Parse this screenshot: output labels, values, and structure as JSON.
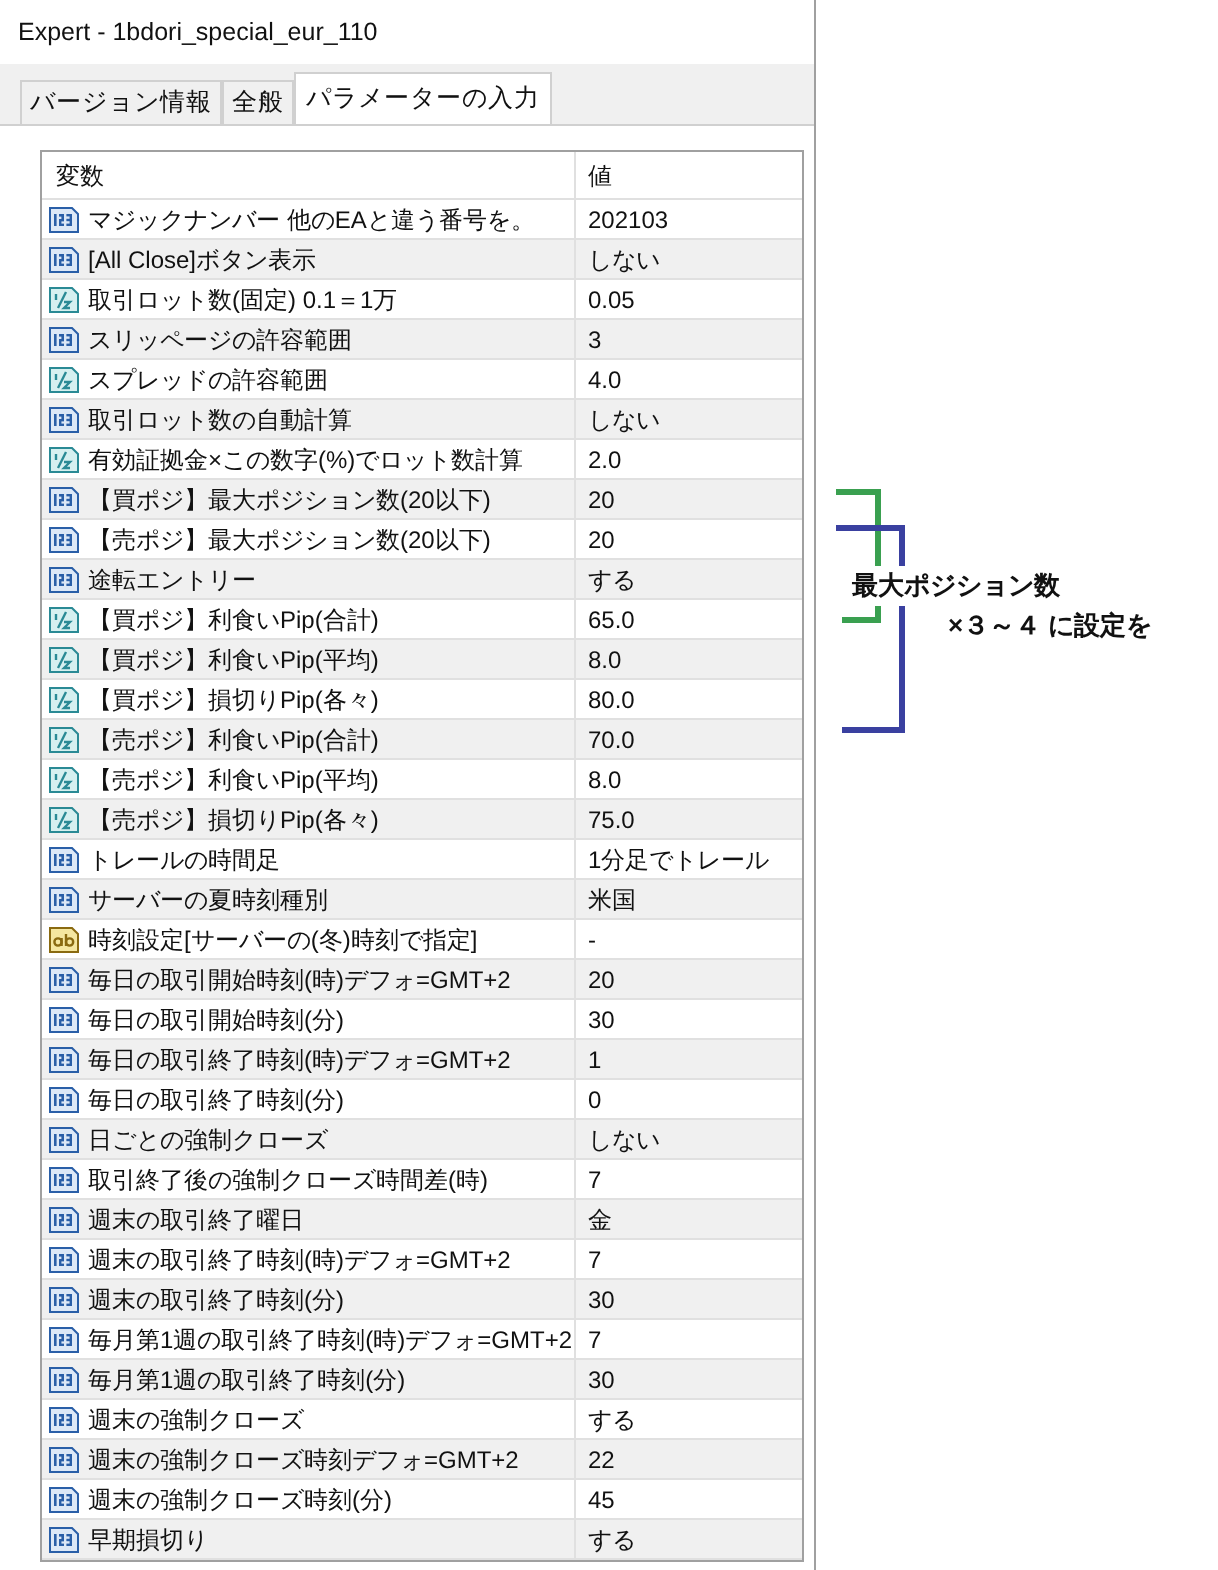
{
  "window": {
    "title": "Expert - 1bdori_special_eur_110"
  },
  "tabs": [
    {
      "label": "バージョン情報",
      "selected": false
    },
    {
      "label": "全般",
      "selected": false
    },
    {
      "label": "パラメーターの入力",
      "selected": true
    }
  ],
  "table": {
    "columns": [
      "変数",
      "値"
    ],
    "rows": [
      {
        "kind": "int",
        "name": "マジックナンバー 他のEAと違う番号を。",
        "value": "202103"
      },
      {
        "kind": "int",
        "name": "[All Close]ボタン表示",
        "value": "しない"
      },
      {
        "kind": "double",
        "name": "取引ロット数(固定) 0.1＝1万",
        "value": "0.05"
      },
      {
        "kind": "int",
        "name": "スリッページの許容範囲",
        "value": "3"
      },
      {
        "kind": "double",
        "name": "スプレッドの許容範囲",
        "value": "4.0"
      },
      {
        "kind": "int",
        "name": "取引ロット数の自動計算",
        "value": "しない"
      },
      {
        "kind": "double",
        "name": "有効証拠金×この数字(%)でロット数計算",
        "value": "2.0"
      },
      {
        "kind": "int",
        "name": "【買ポジ】最大ポジション数(20以下)",
        "value": "20"
      },
      {
        "kind": "int",
        "name": "【売ポジ】最大ポジション数(20以下)",
        "value": "20"
      },
      {
        "kind": "int",
        "name": "途転エントリー",
        "value": "する"
      },
      {
        "kind": "double",
        "name": "【買ポジ】利食いPip(合計)",
        "value": "65.0"
      },
      {
        "kind": "double",
        "name": "【買ポジ】利食いPip(平均)",
        "value": "8.0"
      },
      {
        "kind": "double",
        "name": "【買ポジ】損切りPip(各々)",
        "value": "80.0"
      },
      {
        "kind": "double",
        "name": "【売ポジ】利食いPip(合計)",
        "value": "70.0"
      },
      {
        "kind": "double",
        "name": "【売ポジ】利食いPip(平均)",
        "value": "8.0"
      },
      {
        "kind": "double",
        "name": "【売ポジ】損切りPip(各々)",
        "value": "75.0"
      },
      {
        "kind": "int",
        "name": "トレールの時間足",
        "value": "1分足でトレール"
      },
      {
        "kind": "int",
        "name": "サーバーの夏時刻種別",
        "value": "米国"
      },
      {
        "kind": "string",
        "name": "時刻設定[サーバーの(冬)時刻で指定]",
        "value": "-"
      },
      {
        "kind": "int",
        "name": "毎日の取引開始時刻(時)デフォ=GMT+2",
        "value": "20"
      },
      {
        "kind": "int",
        "name": "毎日の取引開始時刻(分)",
        "value": "30"
      },
      {
        "kind": "int",
        "name": "毎日の取引終了時刻(時)デフォ=GMT+2",
        "value": "1"
      },
      {
        "kind": "int",
        "name": "毎日の取引終了時刻(分)",
        "value": "0"
      },
      {
        "kind": "int",
        "name": "日ごとの強制クローズ",
        "value": "しない"
      },
      {
        "kind": "int",
        "name": "取引終了後の強制クローズ時間差(時)",
        "value": "7"
      },
      {
        "kind": "int",
        "name": "週末の取引終了曜日",
        "value": "金"
      },
      {
        "kind": "int",
        "name": "週末の取引終了時刻(時)デフォ=GMT+2",
        "value": "7"
      },
      {
        "kind": "int",
        "name": "週末の取引終了時刻(分)",
        "value": "30"
      },
      {
        "kind": "int",
        "name": "毎月第1週の取引終了時刻(時)デフォ=GMT+2",
        "value": "7"
      },
      {
        "kind": "int",
        "name": "毎月第1週の取引終了時刻(分)",
        "value": "30"
      },
      {
        "kind": "int",
        "name": "週末の強制クローズ",
        "value": "する"
      },
      {
        "kind": "int",
        "name": "週末の強制クローズ時刻デフォ=GMT+2",
        "value": "22"
      },
      {
        "kind": "int",
        "name": "週末の強制クローズ時刻(分)",
        "value": "45"
      },
      {
        "kind": "int",
        "name": "早期損切り",
        "value": "する"
      }
    ]
  },
  "annotation": {
    "lines": [
      "最大ポジション数",
      "×３～４ に設定を"
    ]
  }
}
